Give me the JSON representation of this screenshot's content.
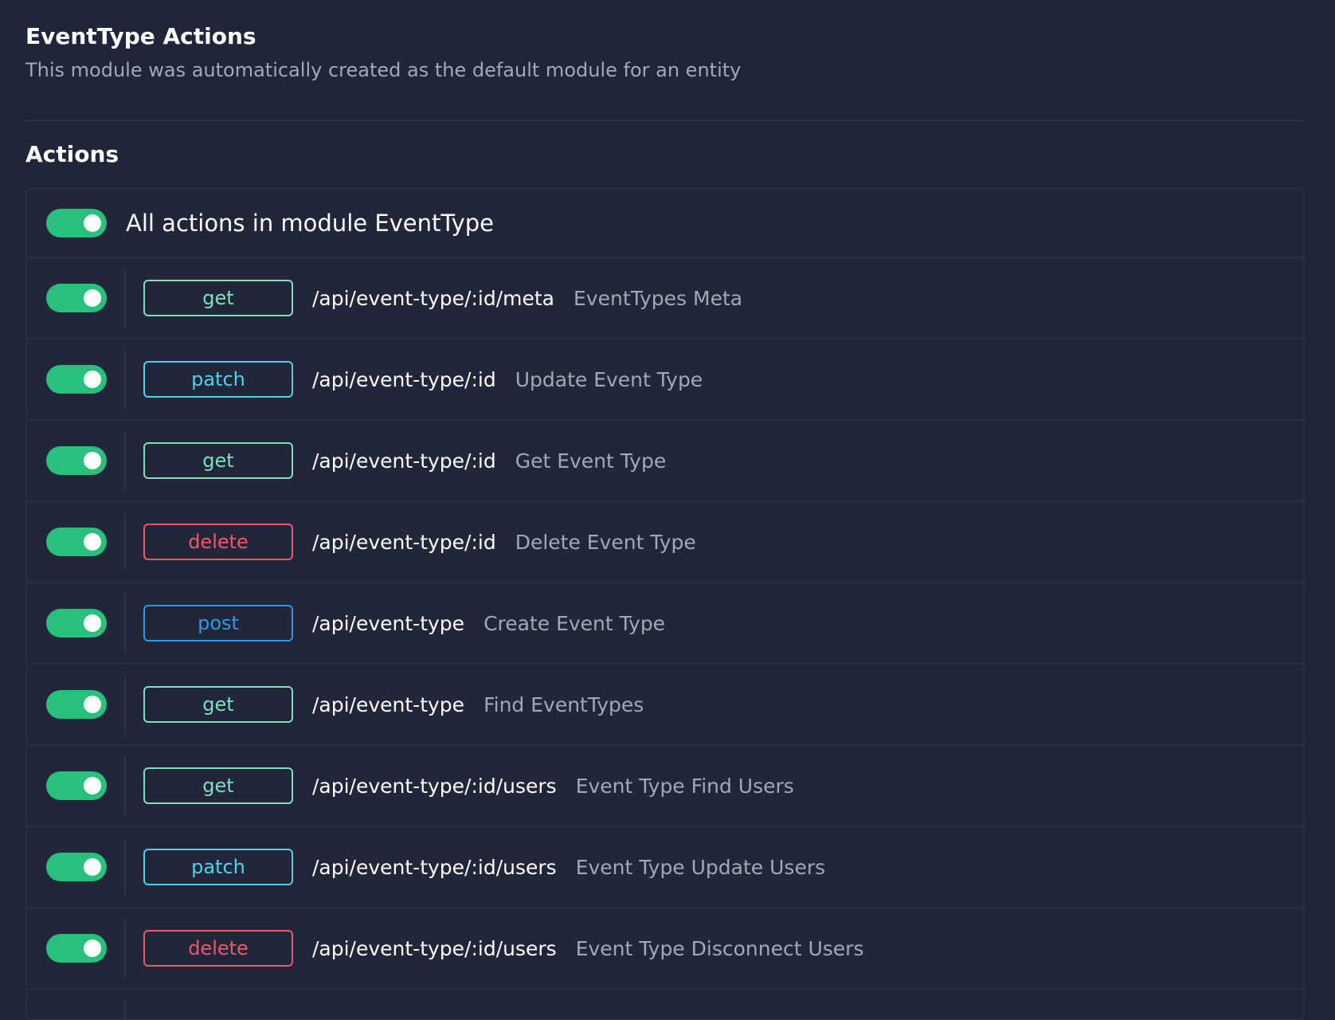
{
  "module": {
    "title": "EventType Actions",
    "description": "This module was automatically created as the default module for an entity"
  },
  "section": {
    "title": "Actions"
  },
  "all_actions": {
    "label": "All actions in module EventType",
    "enabled": true
  },
  "actions": [
    {
      "method": "get",
      "path": "/api/event-type/:id/meta",
      "description": "EventTypes Meta",
      "enabled": true
    },
    {
      "method": "patch",
      "path": "/api/event-type/:id",
      "description": "Update Event Type",
      "enabled": true
    },
    {
      "method": "get",
      "path": "/api/event-type/:id",
      "description": "Get Event Type",
      "enabled": true
    },
    {
      "method": "delete",
      "path": "/api/event-type/:id",
      "description": "Delete Event Type",
      "enabled": true
    },
    {
      "method": "post",
      "path": "/api/event-type",
      "description": "Create Event Type",
      "enabled": true
    },
    {
      "method": "get",
      "path": "/api/event-type",
      "description": "Find EventTypes",
      "enabled": true
    },
    {
      "method": "get",
      "path": "/api/event-type/:id/users",
      "description": "Event Type Find Users",
      "enabled": true
    },
    {
      "method": "patch",
      "path": "/api/event-type/:id/users",
      "description": "Event Type Update Users",
      "enabled": true
    },
    {
      "method": "delete",
      "path": "/api/event-type/:id/users",
      "description": "Event Type Disconnect Users",
      "enabled": true
    }
  ],
  "colors": {
    "background": "#21253a",
    "toggle_on": "#27c07c",
    "get": "#7fe0be",
    "patch": "#4fd2ee",
    "delete": "#f2556a",
    "post": "#2f97e6"
  }
}
